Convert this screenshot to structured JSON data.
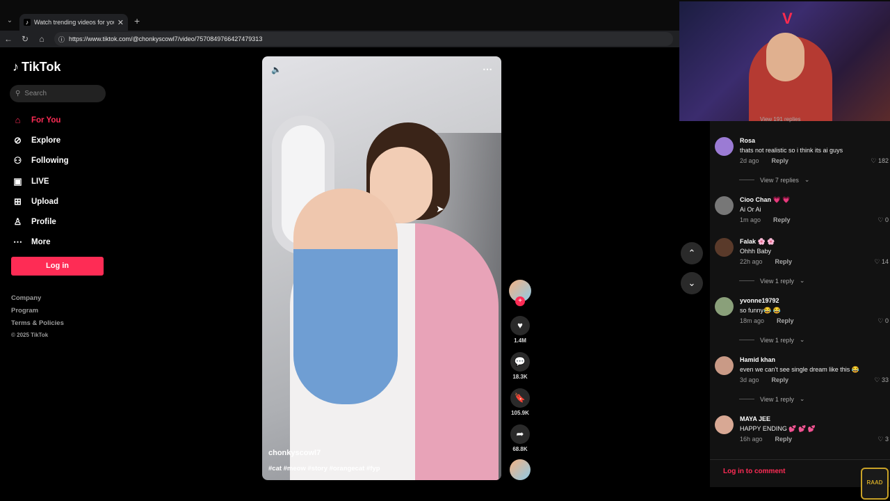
{
  "browser": {
    "tab_title": "Watch trending videos for you | TikTok",
    "new_tab": "+",
    "url": "https://www.tiktok.com/@chonkyscowl7/video/7570849766427479313"
  },
  "sidebar": {
    "logo": "TikTok",
    "search_placeholder": "Search",
    "items": [
      {
        "label": "For You",
        "icon": "home-icon",
        "active": true
      },
      {
        "label": "Explore",
        "icon": "compass-icon"
      },
      {
        "label": "Following",
        "icon": "user-add-icon"
      },
      {
        "label": "LIVE",
        "icon": "live-icon"
      },
      {
        "label": "Upload",
        "icon": "plus-square-icon"
      },
      {
        "label": "Profile",
        "icon": "person-icon"
      },
      {
        "label": "More",
        "icon": "more-icon"
      }
    ],
    "login_label": "Log in",
    "footer": [
      "Company",
      "Program",
      "Terms & Policies",
      "© 2025 TikTok"
    ],
    "accent": "#fe2c55"
  },
  "video": {
    "username": "chonkyscowl7",
    "hashtags": "#cat #meow #story #orangecat #fyp",
    "likes": "1.4M",
    "comments": "18.3K",
    "saves": "105.9K",
    "shares": "68.8K"
  },
  "comments": {
    "top_replies": "View 191 replies",
    "items": [
      {
        "name": "Rosa",
        "text": "thats not realistic so i think its ai guys",
        "time": "2d ago",
        "reply": "Reply",
        "likes": "182",
        "replies": "View 7 replies"
      },
      {
        "name": "Cioo Chan 💗 💗",
        "text": "Ai Or Ai",
        "time": "1m ago",
        "reply": "Reply",
        "likes": "0"
      },
      {
        "name": "Falak 🌸 🌸",
        "text": "Ohhh Baby",
        "time": "22h ago",
        "reply": "Reply",
        "likes": "14",
        "replies": "View 1 reply"
      },
      {
        "name": "yvonne19792",
        "text": "so funny😂 😂",
        "time": "18m ago",
        "reply": "Reply",
        "likes": "0",
        "replies": "View 1 reply"
      },
      {
        "name": "Hamid khan",
        "text": "even we can't see single dream like this 😂",
        "time": "3d ago",
        "reply": "Reply",
        "likes": "33",
        "replies": "View 1 reply"
      },
      {
        "name": "MAYA JEE",
        "text": "HAPPY ENDING 💕 💕 💕",
        "time": "16h ago",
        "reply": "Reply",
        "likes": "3"
      }
    ],
    "login_to_comment": "Log in to comment"
  },
  "overlay": {
    "badge": "RAAD"
  }
}
